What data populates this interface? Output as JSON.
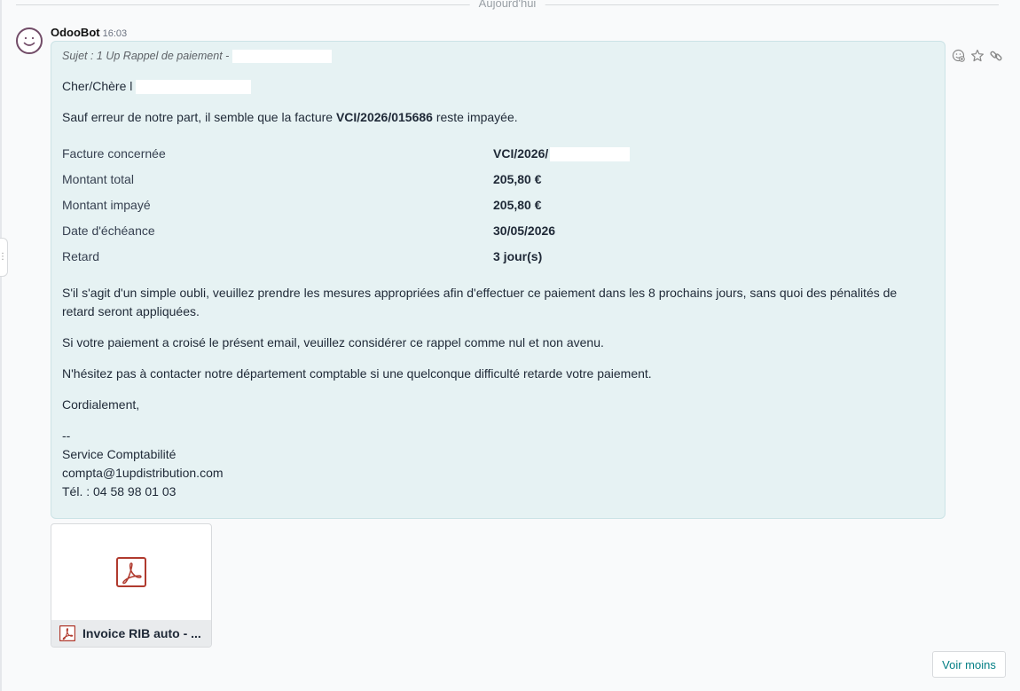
{
  "day_separator": {
    "label": "Aujourd'hui"
  },
  "message": {
    "author": "OdooBot",
    "time": "16:03",
    "subject": "Sujet : 1 Up Rappel de paiement -",
    "greeting": "Cher/Chère l",
    "intro_before": "Sauf erreur de notre part, il semble que la facture ",
    "intro_invoice": "VCI/2026/015686",
    "intro_after": " reste impayée.",
    "details": [
      {
        "label": "Facture concernée",
        "value": "VCI/2026/"
      },
      {
        "label": "Montant total",
        "value": "205,80 €"
      },
      {
        "label": "Montant impayé",
        "value": "205,80 €"
      },
      {
        "label": "Date d'échéance",
        "value": "30/05/2026"
      },
      {
        "label": "Retard",
        "value": "3 jour(s)"
      }
    ],
    "para1_line1": "S'il s'agit d'un simple oubli, veuillez prendre les mesures appropriées afin d'effectuer ce paiement dans les 8 prochains jours, sans quoi des pénalités de",
    "para1_line2": "retard seront appliquées.",
    "para2": "Si votre paiement a croisé le présent email, veuillez considérer ce rappel comme nul et non avenu.",
    "para3": "N'hésitez pas à contacter notre département comptable si une quelconque difficulté retarde votre paiement.",
    "closing": "Cordialement,",
    "signature": {
      "separator": "--",
      "department": "Service Comptabilité",
      "email": "compta@1updistribution.com",
      "phone": "Tél. : 04 58 98 01 03"
    }
  },
  "attachment": {
    "name": "Invoice RIB auto - ...",
    "icon": "pdf-icon"
  },
  "actions": {
    "voir_moins": "Voir moins",
    "icons": [
      "add-reaction-icon",
      "star-icon",
      "link-icon"
    ]
  },
  "colors": {
    "bubble_bg": "#e6f2f3",
    "avatar_ring": "#714b67",
    "pdf_red": "#b03a2e",
    "link_teal": "#017e84"
  }
}
